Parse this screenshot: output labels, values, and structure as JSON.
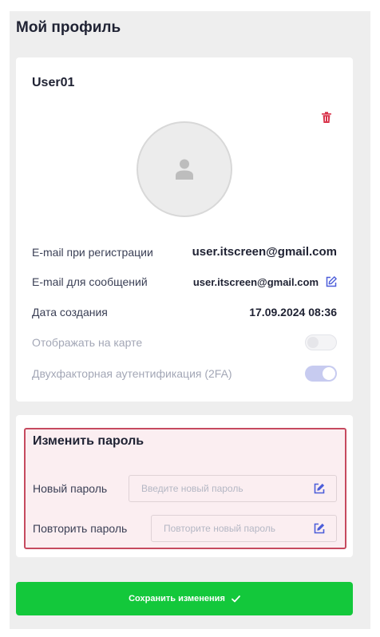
{
  "page": {
    "title": "Мой профиль"
  },
  "profile": {
    "username": "User01",
    "rows": {
      "reg_email": {
        "label": "E-mail при регистрации",
        "value": "user.itscreen@gmail.com"
      },
      "msg_email": {
        "label": "E-mail для сообщений",
        "value": "user.itscreen@gmail.com"
      },
      "created": {
        "label": "Дата создания",
        "value": "17.09.2024 08:36"
      },
      "show_on_map": {
        "label": "Отображать на карте",
        "enabled": false
      },
      "twofa": {
        "label": "Двухфакторная аутентификация (2FA)",
        "enabled": true
      }
    }
  },
  "password": {
    "title": "Изменить пароль",
    "new_label": "Новый пароль",
    "new_placeholder": "Введите новый пароль",
    "repeat_label": "Повторить пароль",
    "repeat_placeholder": "Повторите новый пароль"
  },
  "actions": {
    "save_label": "Сохранить изменения"
  },
  "colors": {
    "accent_green": "#13c83b",
    "danger_red": "#d9344b",
    "link_blue": "#4d5ed9",
    "toggle_on": "#c7cbf0"
  },
  "icons": {
    "delete": "trash-icon",
    "avatar": "user-icon",
    "edit": "edit-icon",
    "save": "check-icon"
  }
}
